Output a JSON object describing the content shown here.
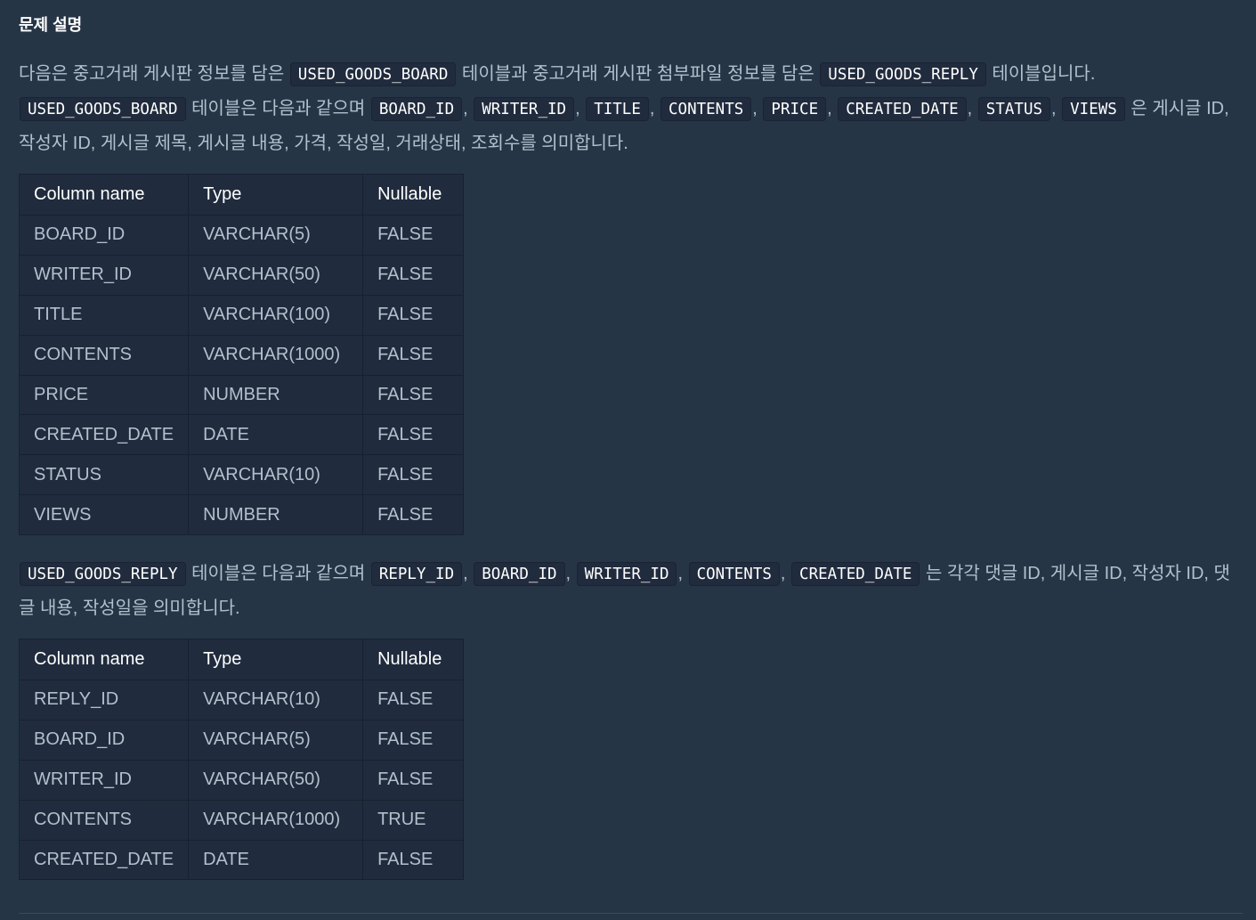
{
  "heading": "문제 설명",
  "p1": {
    "t1": "다음은 중고거래 게시판 정보를 담은 ",
    "c1": "USED_GOODS_BOARD",
    "t2": " 테이블과 중고거래 게시판 첨부파일 정보를 담은 ",
    "c2": "USED_GOODS_REPLY",
    "t3": " 테이블입니다.",
    "c3": "USED_GOODS_BOARD",
    "t4": " 테이블은 다음과 같으며 ",
    "cols": [
      "BOARD_ID",
      "WRITER_ID",
      "TITLE",
      "CONTENTS",
      "PRICE",
      "CREATED_DATE",
      "STATUS",
      "VIEWS"
    ],
    "sep": ",",
    "t5": " 은 게시글 ID, 작성자 ID, 게시글 제목, 게시글 내용, 가격, 작성일, 거래상태, 조회수를 의미합니다."
  },
  "table1": {
    "headers": [
      "Column name",
      "Type",
      "Nullable"
    ],
    "rows": [
      [
        "BOARD_ID",
        "VARCHAR(5)",
        "FALSE"
      ],
      [
        "WRITER_ID",
        "VARCHAR(50)",
        "FALSE"
      ],
      [
        "TITLE",
        "VARCHAR(100)",
        "FALSE"
      ],
      [
        "CONTENTS",
        "VARCHAR(1000)",
        "FALSE"
      ],
      [
        "PRICE",
        "NUMBER",
        "FALSE"
      ],
      [
        "CREATED_DATE",
        "DATE",
        "FALSE"
      ],
      [
        "STATUS",
        "VARCHAR(10)",
        "FALSE"
      ],
      [
        "VIEWS",
        "NUMBER",
        "FALSE"
      ]
    ]
  },
  "p2": {
    "c1": "USED_GOODS_REPLY",
    "t1": " 테이블은 다음과 같으며 ",
    "cols": [
      "REPLY_ID",
      "BOARD_ID",
      "WRITER_ID",
      "CONTENTS",
      "CREATED_DATE"
    ],
    "sep": ",",
    "t2": " 는 각각 댓글 ID, 게시글 ID, 작성자 ID, 댓글 내용, 작성일을 의미합니다."
  },
  "table2": {
    "headers": [
      "Column name",
      "Type",
      "Nullable"
    ],
    "rows": [
      [
        "REPLY_ID",
        "VARCHAR(10)",
        "FALSE"
      ],
      [
        "BOARD_ID",
        "VARCHAR(5)",
        "FALSE"
      ],
      [
        "WRITER_ID",
        "VARCHAR(50)",
        "FALSE"
      ],
      [
        "CONTENTS",
        "VARCHAR(1000)",
        "TRUE"
      ],
      [
        "CREATED_DATE",
        "DATE",
        "FALSE"
      ]
    ]
  }
}
